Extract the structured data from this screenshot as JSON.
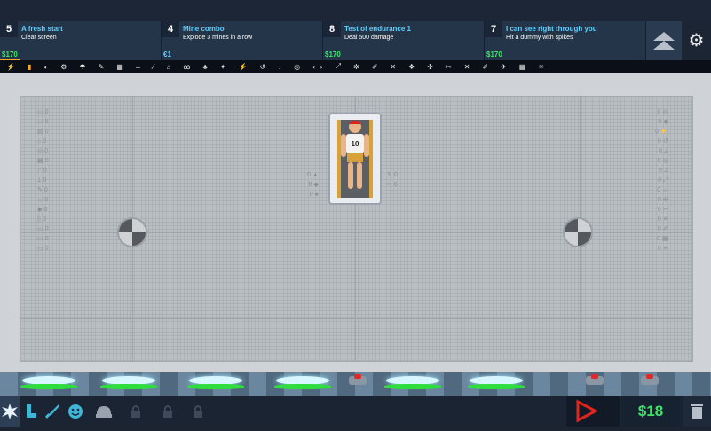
{
  "challenges": [
    {
      "number": "5",
      "title": "A fresh start",
      "desc": "Clear screen",
      "reward": "$170"
    },
    {
      "number": "4",
      "title": "Mine combo",
      "desc": "Explode 3 mines in a row",
      "reward": "€1"
    },
    {
      "number": "8",
      "title": "Test of endurance 1",
      "desc": "Deal 500 damage",
      "reward": "$170"
    },
    {
      "number": "7",
      "title": "I can see right through you",
      "desc": "Hit a dummy with spikes",
      "reward": "$170"
    }
  ],
  "toolbar_icons": [
    "⚡",
    "▮",
    "◐",
    "⚙",
    "☂",
    "✎",
    "▦",
    "⟂",
    "⁄",
    "⌂",
    "ꝏ",
    "♣",
    "✦",
    "⚡",
    "↺",
    "↓",
    "◎",
    "⟷",
    "⤢",
    "✲",
    "✐",
    "✕",
    "❖",
    "✣",
    "✂",
    "✕",
    "✐",
    "✈",
    "▦",
    "✳"
  ],
  "left_stats": [
    "0",
    "0",
    "0",
    "0",
    "0",
    "0",
    "0",
    "0",
    "0",
    "0",
    "0",
    "0",
    "0",
    "0",
    "0"
  ],
  "right_stats": [
    "0",
    "0",
    "0",
    "0",
    "0",
    "0",
    "0",
    "0",
    "0",
    "0",
    "0",
    "0",
    "0",
    "0",
    "0"
  ],
  "dummy": {
    "number": "10",
    "left_stats": [
      "0",
      "0",
      "0"
    ],
    "right_stats": [
      "0",
      "0"
    ]
  },
  "money": "$18",
  "colors": {
    "money": "#3fe36a",
    "challenge_title": "#5fd0ff",
    "play": "#e0251f"
  }
}
